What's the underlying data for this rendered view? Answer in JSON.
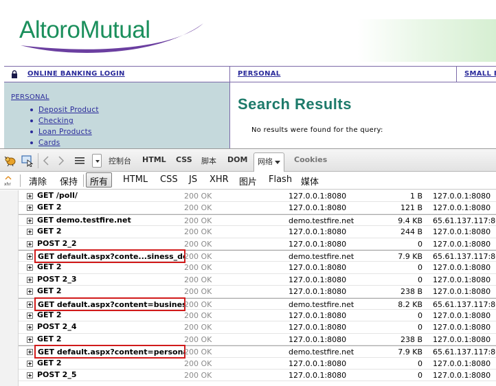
{
  "site": {
    "logo_text": "AltoroMutual",
    "nav": {
      "login": "ONLINE BANKING LOGIN",
      "personal": "PERSONAL",
      "small_business": "SMALL B"
    },
    "sidebar": {
      "heading": "PERSONAL",
      "items": [
        {
          "label": "Deposit Product"
        },
        {
          "label": "Checking"
        },
        {
          "label": "Loan Products"
        },
        {
          "label": "Cards"
        }
      ]
    },
    "main": {
      "title": "Search Results",
      "message": "No results were found for the query:"
    },
    "colors": {
      "brand_green": "#1b8f5c",
      "swoosh_purple": "#6b3fa0",
      "link_blue": "#2a2a9a",
      "sidebar_bg": "#c5d9dc",
      "title_teal": "#1d7a6a",
      "highlight_red": "#d11a1a"
    }
  },
  "firebug": {
    "tools": {
      "inspect_icon": "bug-icon",
      "select_icon": "inspect-element-icon",
      "back_icon": "chevron-left-icon",
      "forward_icon": "chevron-right-icon",
      "menu_icon": "list-menu-icon"
    },
    "tabs": [
      {
        "label": "控制台"
      },
      {
        "label": "HTML"
      },
      {
        "label": "CSS"
      },
      {
        "label": "脚本"
      },
      {
        "label": "DOM"
      },
      {
        "label": "网络"
      },
      {
        "label": "Cookies"
      }
    ],
    "active_tab": "网络",
    "filter_bar": {
      "xhr_icon_label": "xhr",
      "clear": "清除",
      "persist": "保持",
      "filters": [
        {
          "label": "所有"
        },
        {
          "label": "HTML"
        },
        {
          "label": "CSS"
        },
        {
          "label": "JS"
        },
        {
          "label": "XHR"
        },
        {
          "label": "图片"
        },
        {
          "label": "Flash"
        },
        {
          "label": "媒体"
        }
      ],
      "active_filter": "所有"
    }
  },
  "requests": [
    {
      "url": "GET /poll/",
      "status": "200 OK",
      "domain": "127.0.0.1:8080",
      "size": "1 B",
      "ip": "127.0.0.1:8080",
      "highlight": false,
      "new_page": false
    },
    {
      "url": "GET 2",
      "status": "200 OK",
      "domain": "127.0.0.1:8080",
      "size": "121 B",
      "ip": "127.0.0.1:8080",
      "highlight": false,
      "new_page": false
    },
    {
      "url": "GET demo.testfire.net",
      "status": "200 OK",
      "domain": "demo.testfire.net",
      "size": "9.4 KB",
      "ip": "65.61.137.117:80",
      "highlight": false,
      "new_page": true
    },
    {
      "url": "GET 2",
      "status": "200 OK",
      "domain": "127.0.0.1:8080",
      "size": "244 B",
      "ip": "127.0.0.1:8080",
      "highlight": false,
      "new_page": false
    },
    {
      "url": "POST 2_2",
      "status": "200 OK",
      "domain": "127.0.0.1:8080",
      "size": "0",
      "ip": "127.0.0.1:8080",
      "highlight": false,
      "new_page": false
    },
    {
      "url": "GET default.aspx?conte...siness_de",
      "status": "200 OK",
      "domain": "demo.testfire.net",
      "size": "7.9 KB",
      "ip": "65.61.137.117:80",
      "highlight": true,
      "new_page": true
    },
    {
      "url": "GET 2",
      "status": "200 OK",
      "domain": "127.0.0.1:8080",
      "size": "0",
      "ip": "127.0.0.1:8080",
      "highlight": false,
      "new_page": false
    },
    {
      "url": "POST 2_3",
      "status": "200 OK",
      "domain": "127.0.0.1:8080",
      "size": "0",
      "ip": "127.0.0.1:8080",
      "highlight": false,
      "new_page": false
    },
    {
      "url": "GET 2",
      "status": "200 OK",
      "domain": "127.0.0.1:8080",
      "size": "238 B",
      "ip": "127.0.0.1:8080",
      "highlight": false,
      "new_page": false
    },
    {
      "url": "GET default.aspx?content=busines",
      "status": "200 OK",
      "domain": "demo.testfire.net",
      "size": "8.2 KB",
      "ip": "65.61.137.117:80",
      "highlight": true,
      "new_page": true
    },
    {
      "url": "GET 2",
      "status": "200 OK",
      "domain": "127.0.0.1:8080",
      "size": "0",
      "ip": "127.0.0.1:8080",
      "highlight": false,
      "new_page": false
    },
    {
      "url": "POST 2_4",
      "status": "200 OK",
      "domain": "127.0.0.1:8080",
      "size": "0",
      "ip": "127.0.0.1:8080",
      "highlight": false,
      "new_page": false
    },
    {
      "url": "GET 2",
      "status": "200 OK",
      "domain": "127.0.0.1:8080",
      "size": "238 B",
      "ip": "127.0.0.1:8080",
      "highlight": false,
      "new_page": false
    },
    {
      "url": "GET default.aspx?content=persona",
      "status": "200 OK",
      "domain": "demo.testfire.net",
      "size": "7.9 KB",
      "ip": "65.61.137.117:80",
      "highlight": true,
      "new_page": true
    },
    {
      "url": "GET 2",
      "status": "200 OK",
      "domain": "127.0.0.1:8080",
      "size": "0",
      "ip": "127.0.0.1:8080",
      "highlight": false,
      "new_page": false
    },
    {
      "url": "POST 2_5",
      "status": "200 OK",
      "domain": "127.0.0.1:8080",
      "size": "0",
      "ip": "127.0.0.1:8080",
      "highlight": false,
      "new_page": false
    }
  ]
}
